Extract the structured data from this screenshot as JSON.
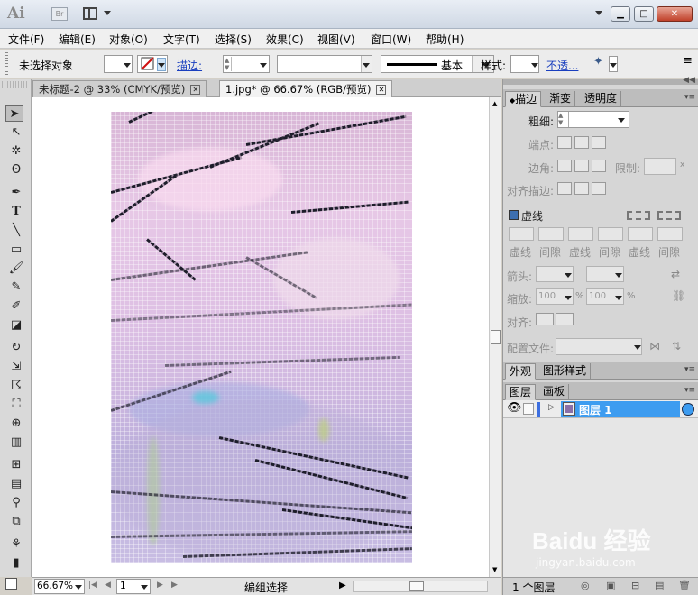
{
  "titlebar": {
    "app_logo": "Ai",
    "bridge_label": "Br",
    "minimize": "▁",
    "maximize": "□",
    "close": "✕"
  },
  "menu": [
    "文件(F)",
    "编辑(E)",
    "对象(O)",
    "文字(T)",
    "选择(S)",
    "效果(C)",
    "视图(V)",
    "窗口(W)",
    "帮助(H)"
  ],
  "control_bar": {
    "selection_status": "未选择对象",
    "stroke_label": "描边:",
    "stroke_profile": "基本",
    "style_label": "样式:",
    "opacity_label": "不透...",
    "menu_icon": "≡"
  },
  "doc_tabs": [
    {
      "label": "未标题-2 @ 33% (CMYK/预览)",
      "active": false
    },
    {
      "label": "1.jpg* @ 66.67% (RGB/预览)",
      "active": true
    }
  ],
  "status_bar": {
    "zoom": "66.67%",
    "artboard": "1",
    "status_text": "编组选择"
  },
  "stroke_panel": {
    "tabs": [
      "描边",
      "渐变",
      "透明度"
    ],
    "weight_label": "粗细:",
    "cap_label": "端点:",
    "corner_label": "边角:",
    "limit_label": "限制:",
    "align_label": "对齐描边:",
    "dashed_label": "虚线",
    "dash_labels": [
      "虚线",
      "间隙",
      "虚线",
      "间隙",
      "虚线",
      "间隙"
    ],
    "arrow_label": "箭头:",
    "scale_label": "缩放:",
    "scale_value_1": "100",
    "scale_value_2": "100",
    "percent": "%",
    "align2_label": "对齐:",
    "profile_label": "配置文件:",
    "limit_unit": "x"
  },
  "appearance_panel": {
    "tabs": [
      "外观",
      "图形样式"
    ]
  },
  "layers_panel": {
    "tabs": [
      "图层",
      "画板"
    ],
    "layer_name": "图层 1",
    "footer_count": "1 个图层"
  },
  "watermark": {
    "brand": "Baidu 经验",
    "url": "jingyan.baidu.com"
  },
  "colors": {
    "accent_selection": "#3d9cf0",
    "link": "#1a3fbf",
    "close_button": "#c0412a"
  }
}
